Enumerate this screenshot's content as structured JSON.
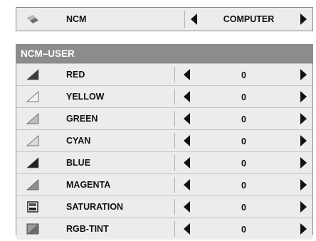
{
  "top": {
    "icon": "ncm-icon",
    "label": "NCM",
    "value": "COMPUTER"
  },
  "panel": {
    "title": "NCM–USER",
    "rows": [
      {
        "label": "RED",
        "value": "0",
        "icon": "red-ramp-icon",
        "shade": "#3a3a3a"
      },
      {
        "label": "YELLOW",
        "value": "0",
        "icon": "yellow-ramp-icon",
        "shade": "#f2f2f2"
      },
      {
        "label": "GREEN",
        "value": "0",
        "icon": "green-ramp-icon",
        "shade": "#bdbdbd"
      },
      {
        "label": "CYAN",
        "value": "0",
        "icon": "cyan-ramp-icon",
        "shade": "#dcdcdc"
      },
      {
        "label": "BLUE",
        "value": "0",
        "icon": "blue-ramp-icon",
        "shade": "#1f1f1f"
      },
      {
        "label": "MAGENTA",
        "value": "0",
        "icon": "magenta-ramp-icon",
        "shade": "#8f8f8f"
      },
      {
        "label": "SATURATION",
        "value": "0",
        "icon": "saturation-icon",
        "shade": "#3a3a3a"
      },
      {
        "label": "RGB-TINT",
        "value": "0",
        "icon": "rgb-tint-icon",
        "shade": "#7a7a7a"
      }
    ]
  }
}
